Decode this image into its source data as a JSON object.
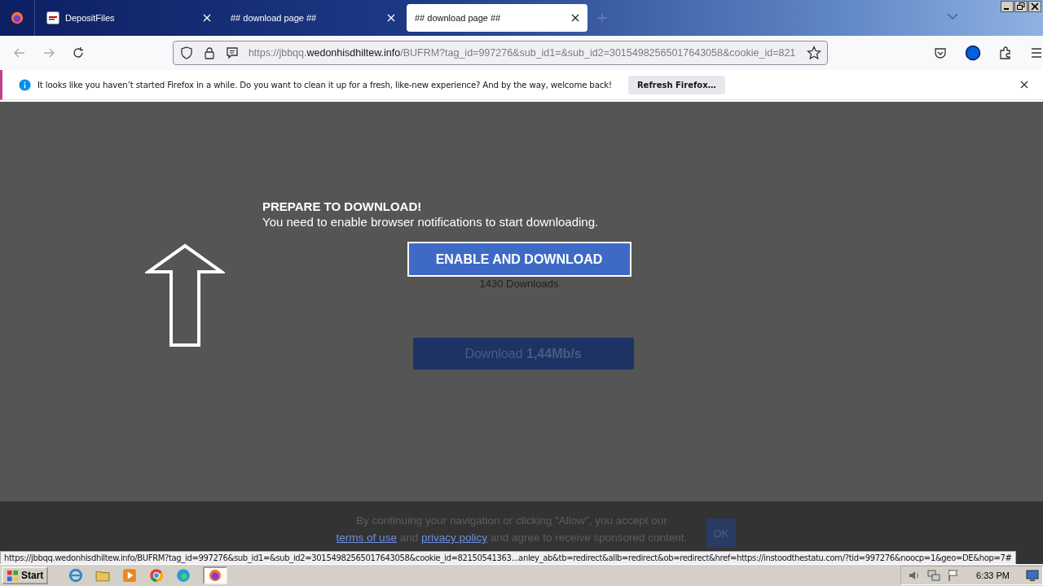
{
  "tabs": [
    {
      "title": "DepositFiles",
      "selected": false,
      "kind": "site"
    },
    {
      "title": "## download page ##",
      "selected": false,
      "kind": "plain"
    },
    {
      "title": "## download page ##",
      "selected": true,
      "kind": "plain"
    }
  ],
  "address_bar": {
    "scheme": "https://jbbqq.",
    "domain": "wedonhisdhiltew.info",
    "path": "/BUFRM?tag_id=997276&sub_id1=&sub_id2=30154982565017643058&cookie_id=821"
  },
  "notification": {
    "message": "It looks like you haven’t started Firefox in a while. Do you want to clean it up for a fresh, like-new experience? And by the way, welcome back!",
    "button": "Refresh Firefox…"
  },
  "page": {
    "heading": "PREPARE TO DOWNLOAD!",
    "subheading": "You need to enable browser notifications to start downloading.",
    "enable_button": "ENABLE AND DOWNLOAD",
    "downloads_count": "1430 Downloads",
    "download_button": "Download **1,44Mb/s**"
  },
  "cookie_bar": {
    "text_before": "By continuing your navigation or clicking \"Allow\", you accept our",
    "terms_link": "terms of use",
    "text_middle": "and",
    "privacy_link": "privacy policy",
    "text_after": "and agree to receive sponsored content.",
    "ok_button": "OK"
  },
  "status_url": "https://jbbqq.wedonhisdhiltew.info/BUFRM?tag_id=997276&sub_id1=&sub_id2=30154982565017643058&cookie_id=82150541363...anley_ab&tb=redirect&allb=redirect&ob=redirect&href=https://instoodthestatu.com/?tid=997276&noocp=1&geo=DE&hop=7#",
  "taskbar": {
    "start": "Start",
    "time": "6:33 PM"
  }
}
